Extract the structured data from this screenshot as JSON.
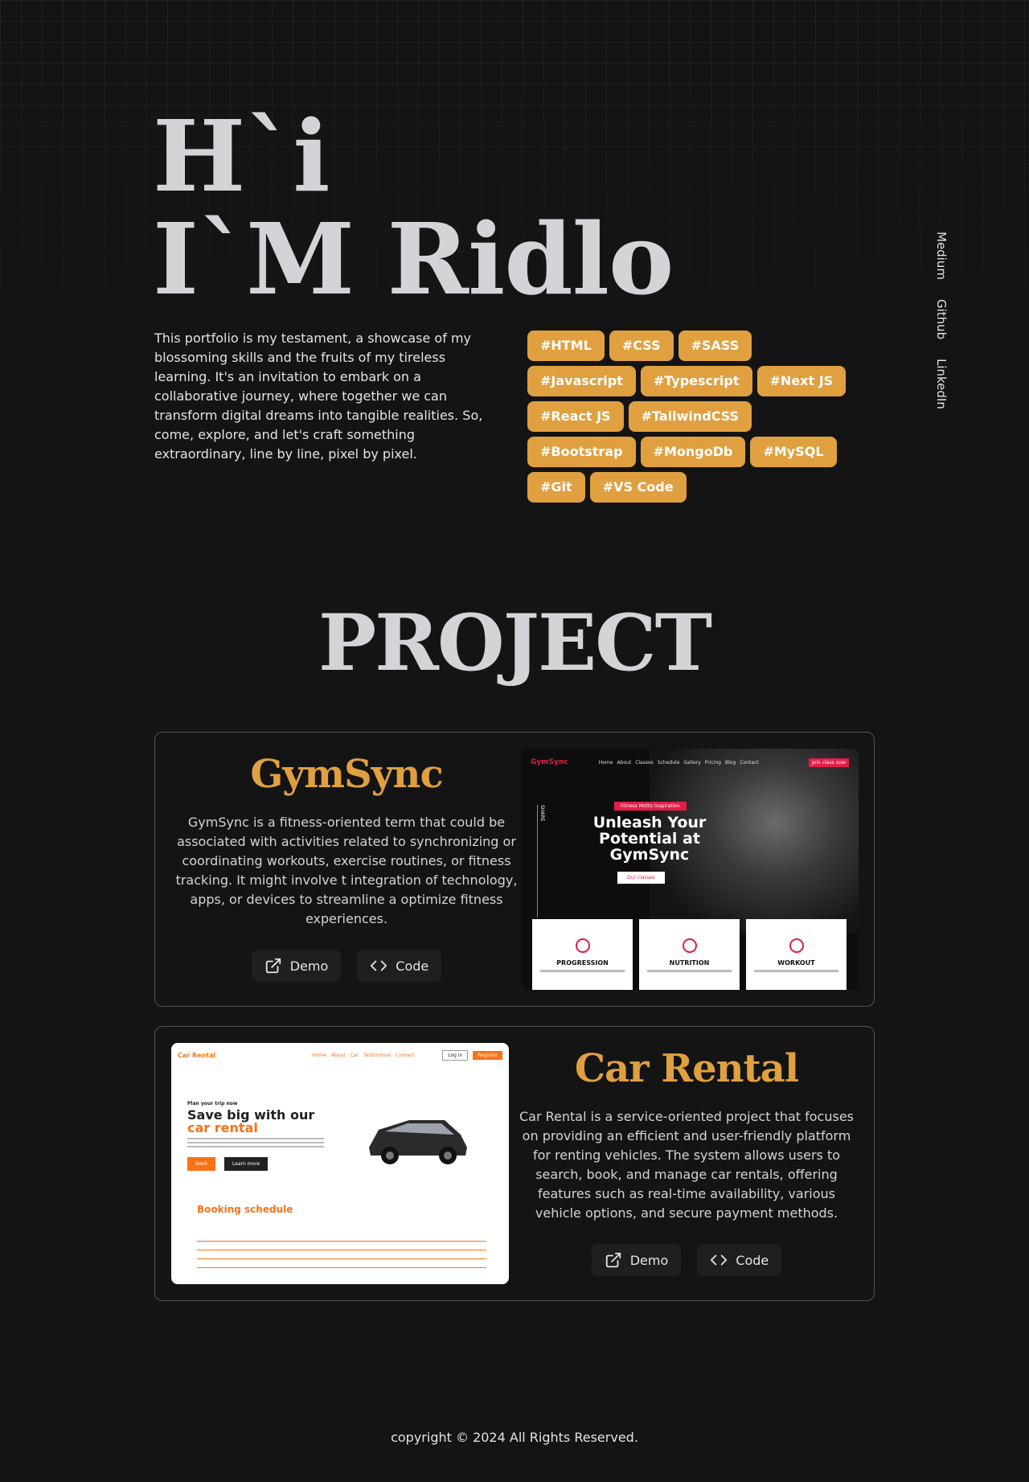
{
  "hero": {
    "line1": "H`i",
    "line2": "I`M Ridlo",
    "intro": "This portfolio is my testament, a showcase of my blossoming skills and the fruits of my tireless learning. It's an invitation to embark on a collaborative journey, where together we can transform digital dreams into tangible realities. So, come, explore, and let's craft something extraordinary, line by line, pixel by pixel."
  },
  "tags": [
    "#HTML",
    "#CSS",
    "#SASS",
    "#Javascript",
    "#Typescript",
    "#Next JS",
    "#React JS",
    "#TailwindCSS",
    "#Bootstrap",
    "#MongoDb",
    "#MySQL",
    "#Git",
    "#VS Code"
  ],
  "social": {
    "medium": "Medium",
    "github": "Github",
    "linkedin": "LinkedIn"
  },
  "projects_section": {
    "title": "PROJECT"
  },
  "projects": [
    {
      "name": "GymSync",
      "description": "GymSync is a fitness-oriented term that could be associated with activities related to synchronizing or coordinating workouts, exercise routines, or fitness tracking. It might involve t integration of technology, apps, or devices to streamline a optimize fitness experiences.",
      "demo_label": "Demo",
      "code_label": "Code",
      "preview": {
        "logo": "GymSync",
        "nav": [
          "Home",
          "About",
          "Classes",
          "Schedule",
          "Gallery",
          "Pricing",
          "Blog",
          "Contact"
        ],
        "join": "Join class now",
        "badge": "Fitness Motto Inspiration",
        "headline": "Unleash Your Potential at GymSync",
        "cta": "Our classes",
        "share": "SHARE",
        "cards": [
          "PROGRESSION",
          "NUTRITION",
          "WORKOUT"
        ]
      }
    },
    {
      "name": "Car Rental",
      "description": "Car Rental is a service-oriented project that focuses on providing an efficient and user-friendly platform for renting vehicles. The system allows users to search, book, and manage car rentals, offering features such as real-time availability, various vehicle options, and secure payment methods.",
      "demo_label": "Demo",
      "code_label": "Code",
      "preview": {
        "brand": "Car Rental",
        "nav": [
          "Home",
          "About",
          "Car",
          "Testimonial",
          "Contact"
        ],
        "login": "Log in",
        "register": "Register",
        "small": "Plan your trip now",
        "headline": "Save big with our",
        "headline_accent": "car rental",
        "book_btn": "Book",
        "learn_btn": "Learn more",
        "booking_title": "Booking schedule"
      }
    }
  ],
  "footer": {
    "copyright": "copyright © 2024 All Rights Reserved."
  },
  "colors": {
    "background": "#141414",
    "accent": "#e0a040",
    "heading": "#d4d4d8"
  }
}
